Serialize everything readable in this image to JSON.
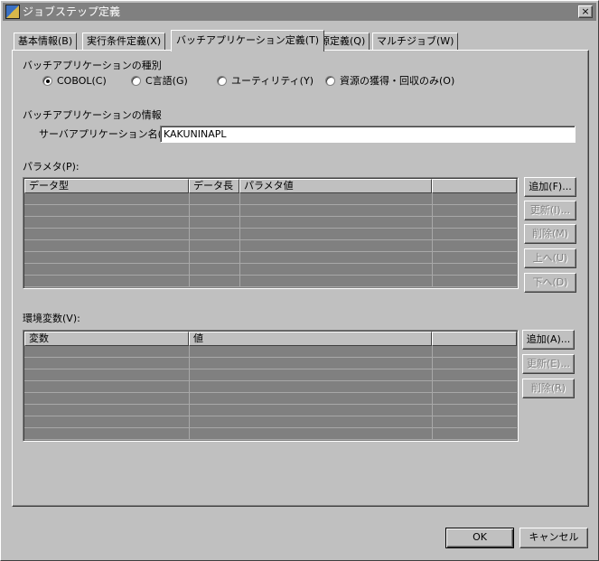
{
  "window": {
    "title": "ジョブステップ定義",
    "close_label": "×"
  },
  "tabs": [
    {
      "label": "基本情報(B)"
    },
    {
      "label": "実行条件定義(X)"
    },
    {
      "label": "バッチアプリケーション定義(T)"
    },
    {
      "label": "資源定義(Q)"
    },
    {
      "label": "マルチジョブ(W)"
    }
  ],
  "active_tab": "バッチアプリケーション定義(T)",
  "batch_type": {
    "heading": "バッチアプリケーションの種別",
    "options": [
      "COBOL(C)",
      "C言語(G)",
      "ユーティリティ(Y)",
      "資源の獲得・回収のみ(O)"
    ],
    "selected": "COBOL(C)"
  },
  "batch_info": {
    "heading": "バッチアプリケーションの情報",
    "server_app_label": "サーバアプリケーション名(S):",
    "server_app_value": "KAKUNINAPL"
  },
  "params": {
    "label": "パラメタ(P):",
    "columns": [
      "データ型",
      "データ長",
      "パラメタ値",
      ""
    ],
    "rows": [],
    "buttons": [
      {
        "label": "追加(F)...",
        "enabled": true
      },
      {
        "label": "更新(I)...",
        "enabled": false
      },
      {
        "label": "削除(M)",
        "enabled": false
      },
      {
        "label": "上へ(U)",
        "enabled": false
      },
      {
        "label": "下へ(D)",
        "enabled": false
      }
    ]
  },
  "env": {
    "label": "環境変数(V):",
    "columns": [
      "変数",
      "値",
      ""
    ],
    "rows": [],
    "buttons": [
      {
        "label": "追加(A)...",
        "enabled": true
      },
      {
        "label": "更新(E)...",
        "enabled": false
      },
      {
        "label": "削除(R)",
        "enabled": false
      }
    ]
  },
  "footer": {
    "ok_label": "OK",
    "cancel_label": "キャンセル"
  }
}
